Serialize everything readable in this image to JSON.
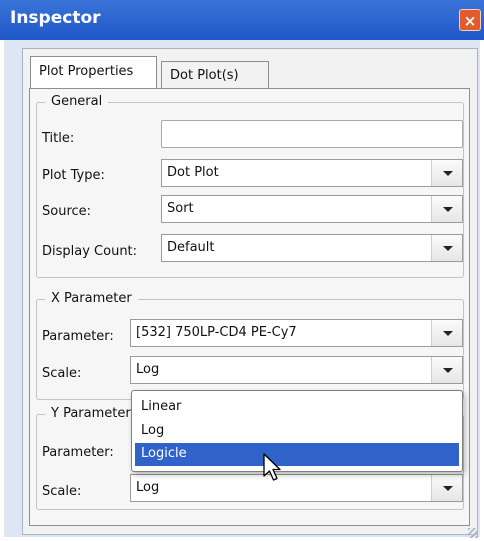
{
  "window": {
    "title": "Inspector",
    "close_label": "×"
  },
  "tabs": [
    {
      "label": "Plot Properties",
      "active": true
    },
    {
      "label": "Dot Plot(s)",
      "active": false
    }
  ],
  "general": {
    "legend": "General",
    "title_label": "Title:",
    "title_value": "",
    "plot_type_label": "Plot Type:",
    "plot_type_value": "Dot Plot",
    "source_label": "Source:",
    "source_value": "Sort",
    "display_count_label": "Display Count:",
    "display_count_value": "Default"
  },
  "x_parameter": {
    "legend": "X Parameter",
    "parameter_label": "Parameter:",
    "parameter_value": "[532] 750LP-CD4 PE-Cy7",
    "scale_label": "Scale:",
    "scale_value": "Log"
  },
  "y_parameter": {
    "legend": "Y Parameter",
    "parameter_label": "Parameter:",
    "scale_label": "Scale:",
    "scale_value": "Log"
  },
  "scale_dropdown": {
    "options": [
      "Linear",
      "Log",
      "Logicle"
    ],
    "highlighted": "Logicle"
  },
  "colors": {
    "title_bar": "#2a63cf",
    "selection": "#2f63c9",
    "close_button": "#e35b2d"
  }
}
